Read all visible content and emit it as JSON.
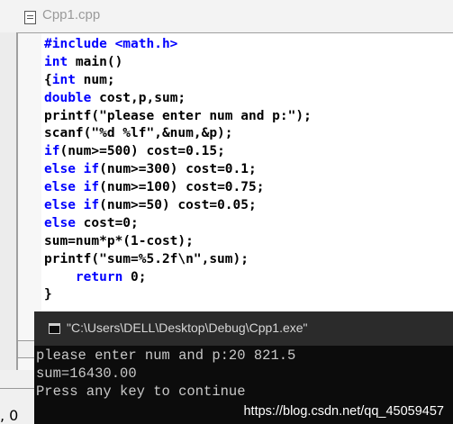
{
  "editor": {
    "file_icon": "document-icon",
    "tab_title": "Cpp1.cpp",
    "code_lines": [
      [
        {
          "t": "#include <math.h>",
          "k": true
        }
      ],
      [
        {
          "t": "int",
          "k": true
        },
        {
          "t": " main()",
          "k": false
        }
      ],
      [
        {
          "t": "{",
          "k": false
        },
        {
          "t": "int",
          "k": true
        },
        {
          "t": " num;",
          "k": false
        }
      ],
      [
        {
          "t": "double",
          "k": true
        },
        {
          "t": " cost,p,sum;",
          "k": false
        }
      ],
      [
        {
          "t": "printf(\"please enter num and p:\");",
          "k": false
        }
      ],
      [
        {
          "t": "scanf(\"%d %lf\",&num,&p);",
          "k": false
        }
      ],
      [
        {
          "t": "if",
          "k": true
        },
        {
          "t": "(num>=500) cost=0.15;",
          "k": false
        }
      ],
      [
        {
          "t": "else",
          "k": true
        },
        {
          "t": " ",
          "k": false
        },
        {
          "t": "if",
          "k": true
        },
        {
          "t": "(num>=300) cost=0.1;",
          "k": false
        }
      ],
      [
        {
          "t": "else",
          "k": true
        },
        {
          "t": " ",
          "k": false
        },
        {
          "t": "if",
          "k": true
        },
        {
          "t": "(num>=100) cost=0.75;",
          "k": false
        }
      ],
      [
        {
          "t": "else",
          "k": true
        },
        {
          "t": " ",
          "k": false
        },
        {
          "t": "if",
          "k": true
        },
        {
          "t": "(num>=50) cost=0.05;",
          "k": false
        }
      ],
      [
        {
          "t": "else",
          "k": true
        },
        {
          "t": " cost=0;",
          "k": false
        }
      ],
      [
        {
          "t": "sum=num*p*(1-cost);",
          "k": false
        }
      ],
      [
        {
          "t": "printf(\"sum=%5.2f\\n\",sum);",
          "k": false
        }
      ],
      [
        {
          "t": "    ",
          "k": false
        },
        {
          "t": "return",
          "k": true
        },
        {
          "t": " 0;",
          "k": false
        }
      ],
      [
        {
          "t": "}",
          "k": false
        }
      ]
    ],
    "status_fragment": ", 0"
  },
  "console": {
    "icon": "console-window-icon",
    "title": "\"C:\\Users\\DELL\\Desktop\\Debug\\Cpp1.exe\"",
    "lines": [
      "please enter num and p:20 821.5",
      "sum=16430.00",
      "Press any key to continue"
    ],
    "watermark": "https://blog.csdn.net/qq_45059457"
  },
  "colors": {
    "keyword": "#0000ff",
    "console_bg": "#0c0c0c",
    "console_titlebar": "#2b2b2b",
    "console_text": "#c8c8c8"
  }
}
